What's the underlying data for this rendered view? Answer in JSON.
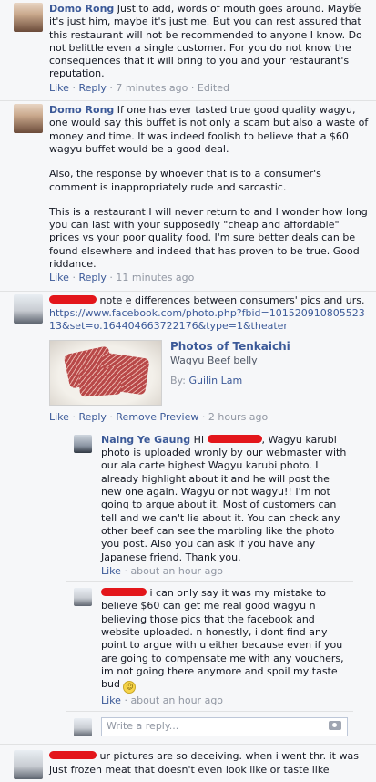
{
  "comments": [
    {
      "author": "Domo Rong",
      "paragraphs": [
        "Just to add, words of mouth goes around. Maybe it's just him, maybe it's just me. But you can rest assured that this restaurant will not be recommended to anyone I know. Do not belittle even a single customer. For you do not know the consequences that it will bring to you and your restaurant's reputation."
      ],
      "like": "Like",
      "reply": "Reply",
      "time": "7 minutes ago",
      "edited": "Edited"
    },
    {
      "author": "Domo Rong",
      "paragraphs": [
        "If one has ever tasted true good quality wagyu, one would say this buffet is not only a scam but also a waste of money and time. It was indeed foolish to believe that a $60 wagyu buffet would be a good deal.",
        "Also, the response by whoever that is to a consumer's comment is inappropriately rude and sarcastic.",
        "This is a restaurant I will never return to and I wonder how long you can last with your supposedly \"cheap and affordable\" prices vs your poor quality food. I'm sure better deals can be found elsewhere and indeed that has proven to be true. Good riddance."
      ],
      "like": "Like",
      "reply": "Reply",
      "time": "11 minutes ago"
    },
    {
      "text": "note e differences between consumers' pics and urs.",
      "link": "https://www.facebook.com/photo.php?fbid=10152091080552313&set=o.164404663722176&type=1&theater",
      "preview": {
        "title": "Photos of Tenkaichi",
        "subtitle": "Wagyu Beef belly",
        "by_label": "By:",
        "by_name": "Guilin Lam"
      },
      "like": "Like",
      "reply": "Reply",
      "remove_preview": "Remove Preview",
      "time": "2 hours ago"
    },
    {
      "text": "ur pictures are so deceiving. when i went thr. it was just frozen meat that doesn't even look like or taste like"
    }
  ],
  "replies": [
    {
      "author": "Naing Ye Gaung",
      "greeting": "Hi",
      "text": ", Wagyu karubi photo is uploaded wronly by our webmaster with our ala carte highest Wagyu karubi photo. I already highlight about it and he will post the new one again. Wagyu or not wagyu!! I'm not going to argue about it. Most of customers can tell and we can't lie about it. You can check any other beef can see the marbling like the photo you post. Also you can ask if you have any Japanese friend. Thank you.",
      "like": "Like",
      "time": "about an hour ago"
    },
    {
      "text": "i can only say it was my mistake to believe $60 can get me real good wagyu n believing those pics that the facebook and website uploaded. n honestly, i dont find any point to argue with u either because even if you are going to compensate me with any vouchers, im not going there anymore and spoil my taste bud",
      "emoji": "☺",
      "like": "Like",
      "time": "about an hour ago"
    }
  ],
  "reply_box": {
    "placeholder": "Write a reply..."
  },
  "close_glyph": "×",
  "separator": "·"
}
